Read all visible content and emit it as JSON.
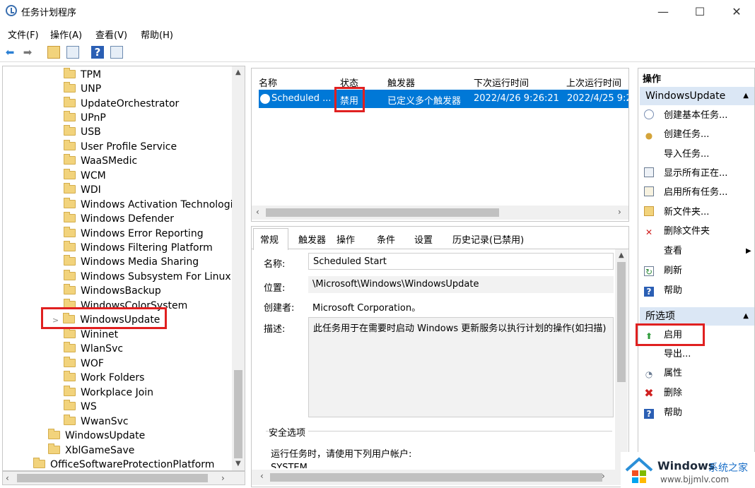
{
  "window": {
    "title": "任务计划程序",
    "minimize": "—",
    "maximize": "☐",
    "close": "✕"
  },
  "menu": [
    "文件(F)",
    "操作(A)",
    "查看(V)",
    "帮助(H)"
  ],
  "toolbar": {
    "back": "⬅",
    "forward": "➡",
    "help": "?"
  },
  "tree": {
    "items": [
      "TPM",
      "UNP",
      "UpdateOrchestrator",
      "UPnP",
      "USB",
      "User Profile Service",
      "WaaSMedic",
      "WCM",
      "WDI",
      "Windows Activation Technologies",
      "Windows Defender",
      "Windows Error Reporting",
      "Windows Filtering Platform",
      "Windows Media Sharing",
      "Windows Subsystem For Linux",
      "WindowsBackup",
      "WindowsColorSystem",
      "WindowsUpdate",
      "Wininet",
      "WlanSvc",
      "WOF",
      "Work Folders",
      "Workplace Join",
      "WS",
      "WwanSvc"
    ],
    "parent_items": [
      "WindowsUpdate",
      "XblGameSave"
    ],
    "root_items": [
      "OfficeSoftwareProtectionPlatform"
    ],
    "expander": ">"
  },
  "tasks": {
    "headers": [
      "名称",
      "状态",
      "触发器",
      "下次运行时间",
      "上次运行时间"
    ],
    "row": {
      "name": "Scheduled ...",
      "status": "禁用",
      "trigger": "已定义多个触发器",
      "next": "2022/4/26 9:26:21",
      "last": "2022/4/25 9:2"
    }
  },
  "detail": {
    "tabs": [
      "常规",
      "触发器",
      "操作",
      "条件",
      "设置",
      "历史记录(已禁用)"
    ],
    "name_label": "名称:",
    "name_value": "Scheduled Start",
    "location_label": "位置:",
    "location_value": "\\Microsoft\\Windows\\WindowsUpdate",
    "author_label": "创建者:",
    "author_value": "Microsoft Corporation。",
    "desc_label": "描述:",
    "desc_value": "此任务用于在需要时启动 Windows 更新服务以执行计划的操作(如扫描)",
    "security_title": "安全选项",
    "run_as_label": "运行任务时，请使用下列用户帐户:",
    "run_as_value": "SYSTEM"
  },
  "actions": {
    "header": "操作",
    "section1": "WindowsUpdate",
    "items1": [
      "创建基本任务...",
      "创建任务...",
      "导入任务...",
      "显示所有正在...",
      "启用所有任务...",
      "新文件夹...",
      "删除文件夹",
      "查看",
      "刷新",
      "帮助"
    ],
    "section2": "所选项",
    "items2": [
      "启用",
      "导出...",
      "属性",
      "删除",
      "帮助"
    ]
  },
  "watermark": {
    "brand": "Windows",
    "site_cn": "系统之家",
    "url": "www.bjjmlv.com"
  },
  "colors": {
    "selection": "#0078d7",
    "highlight_box": "#e02020",
    "section_bg": "#dbe7f5"
  }
}
